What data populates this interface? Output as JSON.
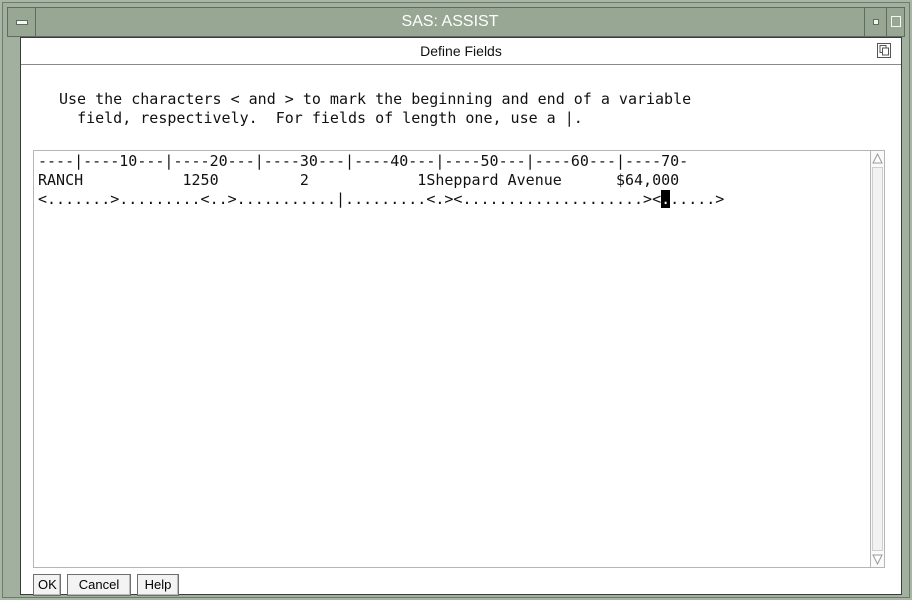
{
  "window": {
    "title": "SAS: ASSIST"
  },
  "dialog": {
    "title": "Define Fields"
  },
  "instructions": {
    "lines": [
      "Use the characters < and > to mark the beginning and end of a variable",
      "field, respectively.  For fields of length one, use a |."
    ]
  },
  "editor": {
    "ruler": "----|----10---|----20---|----30---|----40---|----50---|----60---|----70-",
    "data_row": "RANCH           1250         2            1Sheppard Avenue      $64,000",
    "marker_before_cursor": "<.......>.........<..>...........|.........<.><....................><",
    "marker_cursor": ".",
    "marker_after_cursor": ".....>"
  },
  "buttons": {
    "ok": "OK",
    "cancel": "Cancel",
    "help": "Help"
  },
  "icons": {
    "window_menu": "window-menu-icon",
    "minimize": "minimize-icon",
    "maximize": "maximize-icon",
    "copy": "copy-icon",
    "scroll_up": "scroll-up-arrow-icon",
    "scroll_down": "scroll-down-arrow-icon"
  },
  "colors": {
    "frame": "#a2b09f",
    "titlebar": "#97a794",
    "title_text": "#ffffff",
    "dialog_bg": "#ffffff"
  }
}
